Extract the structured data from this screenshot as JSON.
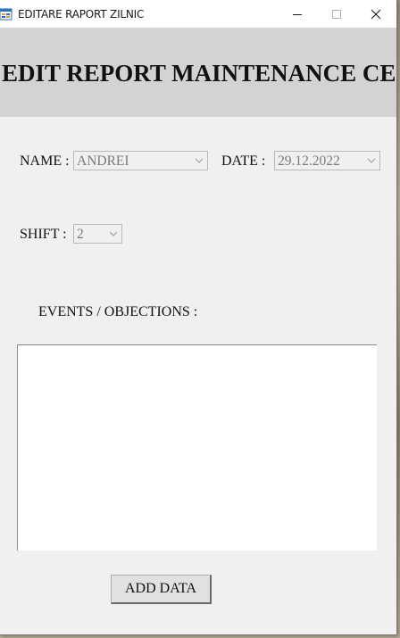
{
  "window": {
    "title": "EDITARE RAPORT ZILNIC"
  },
  "titlebar_icons": [
    "app-icon",
    "minimize-icon",
    "maximize-icon",
    "close-icon"
  ],
  "header": {
    "title": "EDIT REPORT MAINTENANCE CE"
  },
  "form": {
    "name_label": "NAME :",
    "name_value": "ANDREI",
    "date_label": "DATE :",
    "date_value": "29.12.2022",
    "shift_label": "SHIFT :",
    "shift_value": "2",
    "events_label": "EVENTS / OBJECTIONS :",
    "events_text": ""
  },
  "actions": {
    "add_label": "ADD DATA"
  },
  "colors": {
    "header_bg": "#d3d3d3",
    "window_bg": "#f0f0f0",
    "disabled_text": "#7a7a7a"
  }
}
